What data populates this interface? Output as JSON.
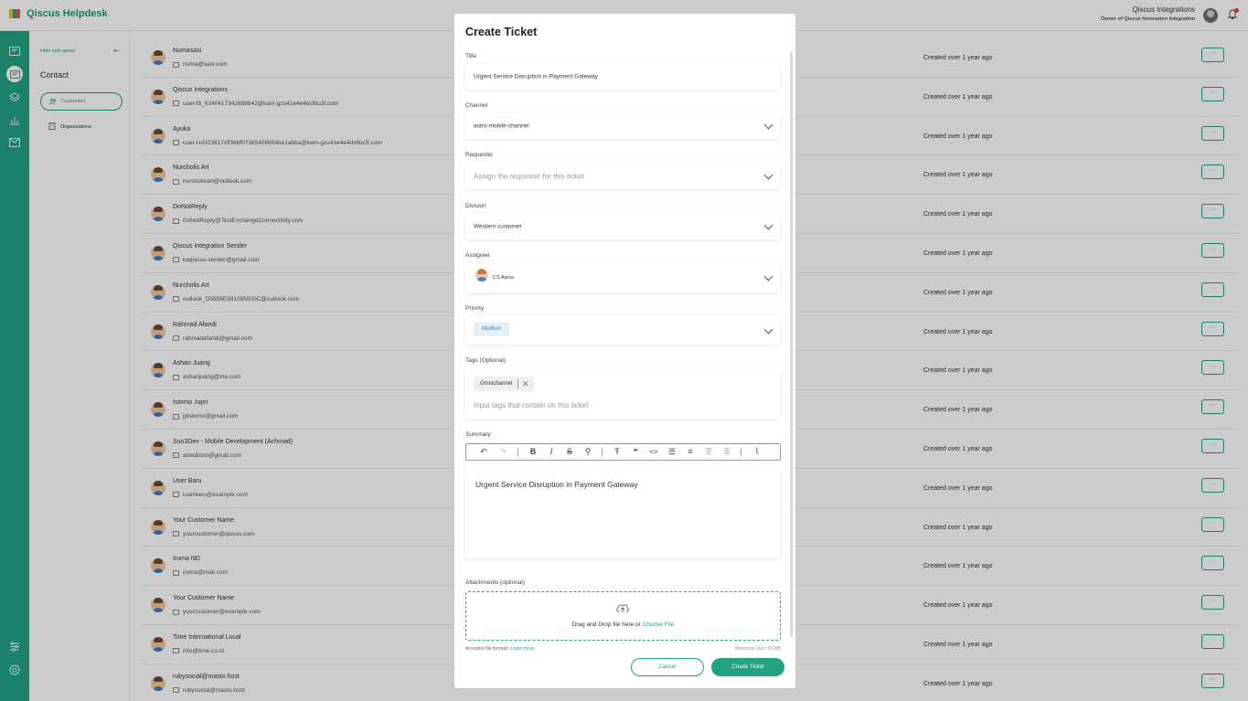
{
  "app": {
    "name": "Qiscus Helpdesk"
  },
  "user": {
    "name": "Qiscus Integrations",
    "role": "Owner of Qiscus Innovation Integration"
  },
  "subnav": {
    "hide_label": "Hide side panel",
    "title": "Contact",
    "items": [
      {
        "label": "Customers",
        "active": true
      },
      {
        "label": "Organizations",
        "active": false
      }
    ]
  },
  "contacts": [
    {
      "name": "Numasasi",
      "email": "numa@sasi.com",
      "created": "Created over 1 year ago"
    },
    {
      "name": "Qiscus Integrations",
      "email": "user-fb_6340417342688642@kam-gzu41e4e4dv8tu3f.com",
      "created": "Created over 1 year ago"
    },
    {
      "name": "Ayuka",
      "email": "user-Ud323617sff36bf07365408654be1abba@kam-gzu41e4e4dv8tu3f.com",
      "created": "Created over 1 year ago"
    },
    {
      "name": "Nurcholis Art",
      "email": "nurcholisart@outlook.com",
      "created": "Created over 1 year ago"
    },
    {
      "name": "DoNotReply",
      "email": "DoNotReply@TestExchangeConnectivity.com",
      "created": "Created over 1 year ago"
    },
    {
      "name": "Qiscus Integration Sender",
      "email": "kaqiscus-sender@gmail.com",
      "created": "Created over 1 year ago"
    },
    {
      "name": "Nurcholis Art",
      "email": "outlook_D5656E991085500C@outlook.com",
      "created": "Created over 1 year ago"
    },
    {
      "name": "Rahmad Afandi",
      "email": "rahmadafandi@gmail.com",
      "created": "Created over 1 year ago"
    },
    {
      "name": "Ashari Juang",
      "email": "asharijuang@me.com",
      "created": "Created over 1 year ago"
    },
    {
      "name": "Istomo Jupri",
      "email": "jpistomo@gmail.com",
      "created": "Created over 1 year ago"
    },
    {
      "name": "Sun3Dev - Mobile Development (Achmad)",
      "email": "amedismi@gmail.com",
      "created": "Created over 1 year ago"
    },
    {
      "name": "User Baru",
      "email": "userbaru@example.com",
      "created": "Created over 1 year ago"
    },
    {
      "name": "Your Customer Name",
      "email": "yourcustomer@qiscus.com",
      "created": "Created over 1 year ago"
    },
    {
      "name": "Iruma ND",
      "email": "iruma@mail.com",
      "created": "Created over 1 year ago"
    },
    {
      "name": "Your Customer Name",
      "email": "yourcustomer@example.com",
      "created": "Created over 1 year ago"
    },
    {
      "name": "Time International Local",
      "email": "info@time.co.id",
      "created": "Created over 1 year ago"
    },
    {
      "name": "rubysocial@masto.host",
      "email": "rubysocial@masto.host",
      "created": "Created over 1 year ago"
    }
  ],
  "row_action_label": "···",
  "modal": {
    "title": "Create Ticket",
    "title_label": "Title",
    "title_value": "Urgent Service Disruption in Payment Gateway",
    "channel_label": "Channel",
    "channel_value": "astro-mobile-channel",
    "requester_label": "Requester",
    "requester_placeholder": "Assign the requester for this ticket",
    "division_label": "Division",
    "division_value": "Western customer",
    "assignee_label": "Assignee",
    "assignee_value": "CS Alena",
    "priority_label": "Priority",
    "priority_value": "Medium",
    "tags_label": "Tags (Optional)",
    "tags": [
      "Omnichannel"
    ],
    "tags_placeholder": "Input tags that contain on this ticket",
    "summary_label": "Summary",
    "summary_text": "Urgent Service Disruption in Payment Gateway",
    "attachments_label": "Attachments (optional)",
    "drop_text": "Drag and Drop file here or ",
    "choose_file": "Choose File",
    "formats_text": "Accepted file formats: ",
    "learn_more": "Learn more",
    "max_size": "Maximum Size: 50 MB",
    "cancel_label": "Cancel",
    "create_label": "Create Ticket"
  },
  "colors": {
    "accent": "#23a285",
    "overlay": "rgba(0,0,0,0.20)",
    "priority_badge_bg": "#e3f1fb",
    "priority_badge_text": "#2f86c7"
  }
}
